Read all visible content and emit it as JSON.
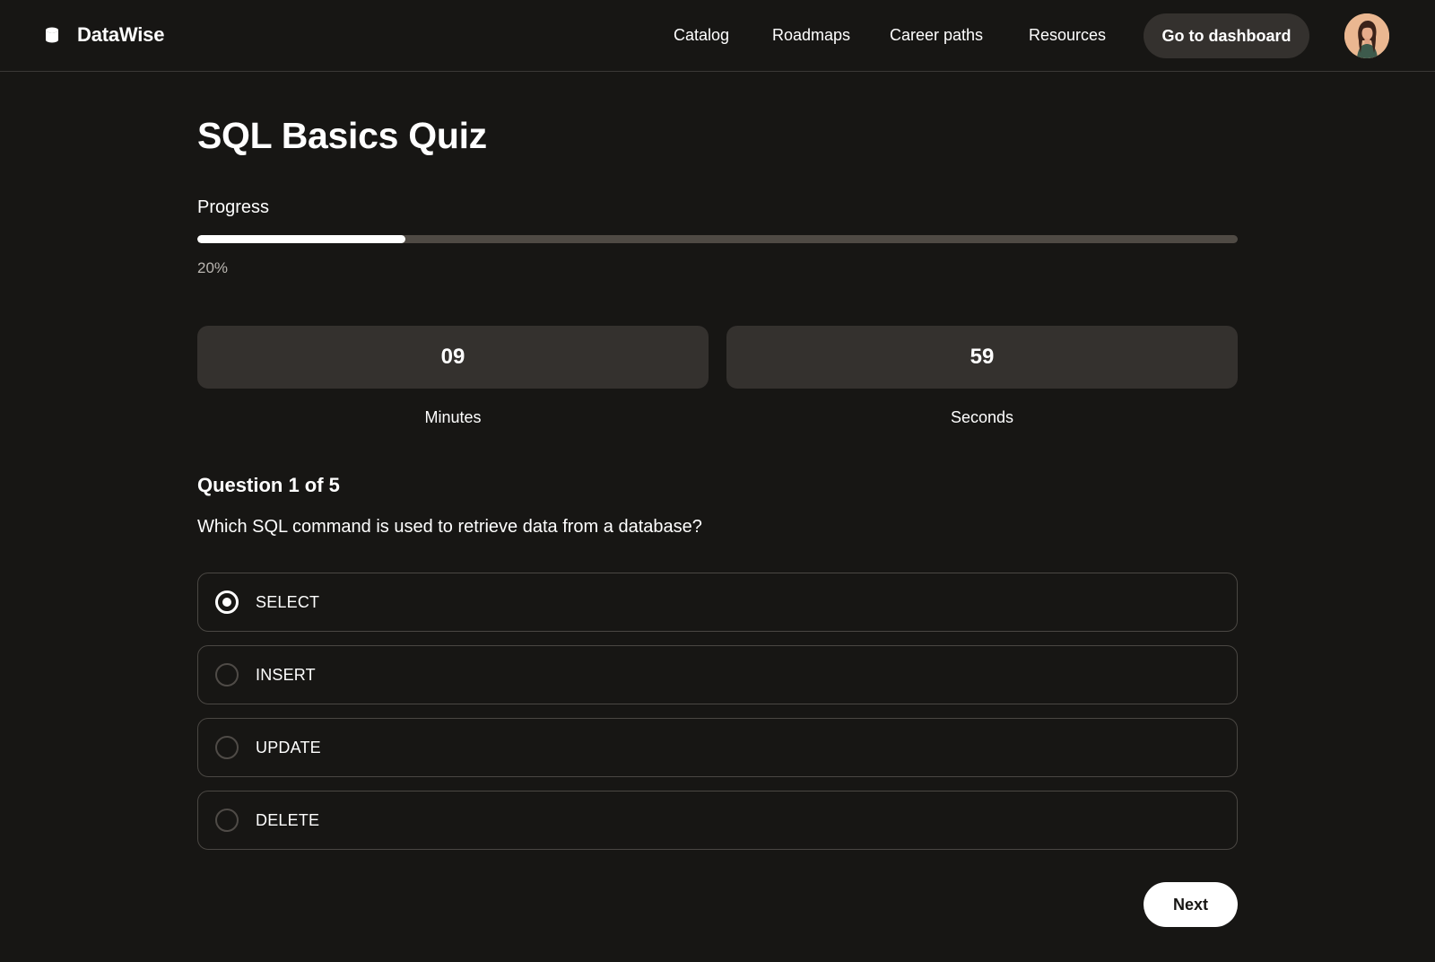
{
  "header": {
    "brand_icon": "database-icon",
    "brand_name": "DataWise",
    "nav": [
      "Catalog",
      "Roadmaps",
      "Career paths",
      "Resources"
    ],
    "dashboard_button": "Go to dashboard",
    "avatar": "user-avatar"
  },
  "quiz": {
    "title": "SQL Basics Quiz",
    "progress_label": "Progress",
    "progress_value": 0.2,
    "progress_text": "20%",
    "timer": {
      "minutes": "09",
      "minutes_label": "Minutes",
      "seconds": "59",
      "seconds_label": "Seconds"
    },
    "question_heading": "Question 1 of 5",
    "question_text": "Which SQL command is used to retrieve data from a database?",
    "options": [
      "SELECT",
      "INSERT",
      "UPDATE",
      "DELETE"
    ],
    "selected_index": 0,
    "next_label": "Next"
  },
  "colors": {
    "background": "#171614",
    "surface": "#34312e",
    "track": "#4f4a44",
    "text": "#ffffff"
  }
}
